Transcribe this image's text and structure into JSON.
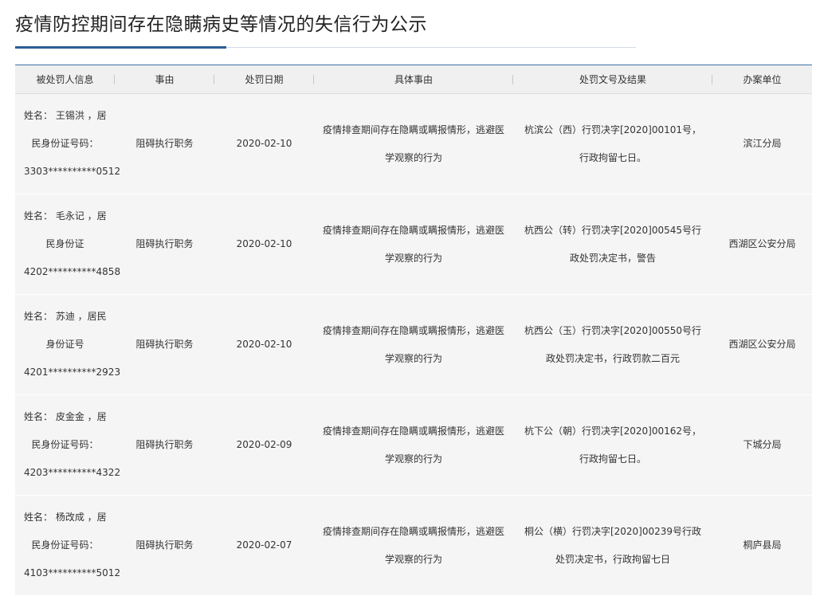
{
  "page": {
    "title": "疫情防控期间存在隐瞒病史等情况的失信行为公示"
  },
  "table": {
    "headers": [
      "被处罚人信息",
      "事由",
      "处罚日期",
      "具体事由",
      "处罚文号及结果",
      "办案单位"
    ],
    "rows": [
      {
        "person": [
          "姓名： 王锡洪 ，居",
          "民身份证号码：",
          "3303**********0512"
        ],
        "reason": "阻碍执行职务",
        "date": "2020-02-10",
        "detail": "疫情排查期间存在隐瞒或瞒报情形，逃避医学观察的行为",
        "result": "杭滨公（西）行罚决字[2020]00101号，行政拘留七日。",
        "unit": "滨江分局"
      },
      {
        "person": [
          "姓名： 毛永记 ，居",
          "民身份证",
          "4202**********4858"
        ],
        "reason": "阻碍执行职务",
        "date": "2020-02-10",
        "detail": "疫情排查期间存在隐瞒或瞒报情形，逃避医学观察的行为",
        "result": "杭西公（转）行罚决字[2020]00545号行政处罚决定书，警告",
        "unit": "西湖区公安分局"
      },
      {
        "person": [
          "姓名： 苏迪 ，居民",
          "身份证号",
          "4201**********2923"
        ],
        "reason": "阻碍执行职务",
        "date": "2020-02-10",
        "detail": "疫情排查期间存在隐瞒或瞒报情形，逃避医学观察的行为",
        "result": "杭西公（玉）行罚决字[2020]00550号行政处罚决定书，行政罚款二百元",
        "unit": "西湖区公安分局"
      },
      {
        "person": [
          "姓名： 皮金金 ，居",
          "民身份证号码：",
          "4203**********4322"
        ],
        "reason": "阻碍执行职务",
        "date": "2020-02-09",
        "detail": "疫情排查期间存在隐瞒或瞒报情形，逃避医学观察的行为",
        "result": "杭下公（朝）行罚决字[2020]00162号，行政拘留七日。",
        "unit": "下城分局"
      },
      {
        "person": [
          "姓名： 杨改成 ，居",
          "民身份证号码：",
          "4103**********5012"
        ],
        "reason": "阻碍执行职务",
        "date": "2020-02-07",
        "detail": "疫情排查期间存在隐瞒或瞒报情形，逃避医学观察的行为",
        "result": "桐公（横）行罚决字[2020]00239号行政处罚决定书，行政拘留七日",
        "unit": "桐庐县局"
      }
    ]
  }
}
